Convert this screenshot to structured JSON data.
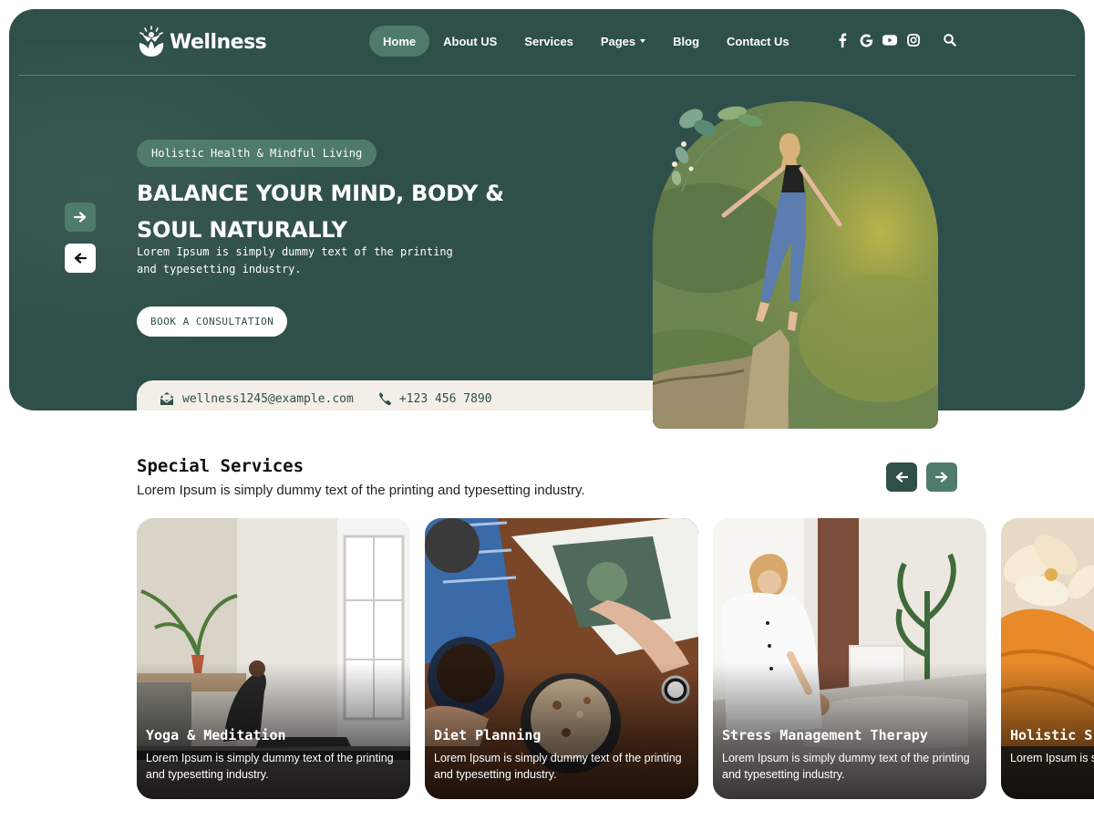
{
  "brand": {
    "name": "Wellness"
  },
  "nav": {
    "items": [
      {
        "label": "Home"
      },
      {
        "label": "About US"
      },
      {
        "label": "Services"
      },
      {
        "label": "Pages"
      },
      {
        "label": "Blog"
      },
      {
        "label": "Contact Us"
      }
    ],
    "active_index": 0
  },
  "social": [
    "facebook-icon",
    "google-icon",
    "youtube-icon",
    "instagram-icon"
  ],
  "hero": {
    "tagline": "Holistic Health & Mindful Living",
    "title": "BALANCE YOUR MIND, BODY & SOUL NATURALLY",
    "description": "Lorem Ipsum is simply dummy text of the printing and typesetting industry.",
    "cta_label": "BOOK A CONSULTATION",
    "email": "wellness1245@example.com",
    "phone": "+123 456 7890"
  },
  "services": {
    "title": "Special Services",
    "subtitle": "Lorem Ipsum is simply dummy text of the printing and typesetting industry.",
    "cards": [
      {
        "title": "Yoga & Meditation",
        "description": "Lorem Ipsum is simply dummy text of the printing and typesetting industry."
      },
      {
        "title": "Diet Planning",
        "description": "Lorem Ipsum is simply dummy text of the printing and typesetting industry."
      },
      {
        "title": "Stress Management Therapy",
        "description": "Lorem Ipsum is simply dummy text of the printing and typesetting industry."
      },
      {
        "title": "Holistic S",
        "description": "Lorem Ipsum is s and typesetting"
      }
    ]
  },
  "colors": {
    "hero_bg": "#2f4f4a",
    "accent": "#4e7b6b",
    "contact_bar": "#f3efe8"
  }
}
